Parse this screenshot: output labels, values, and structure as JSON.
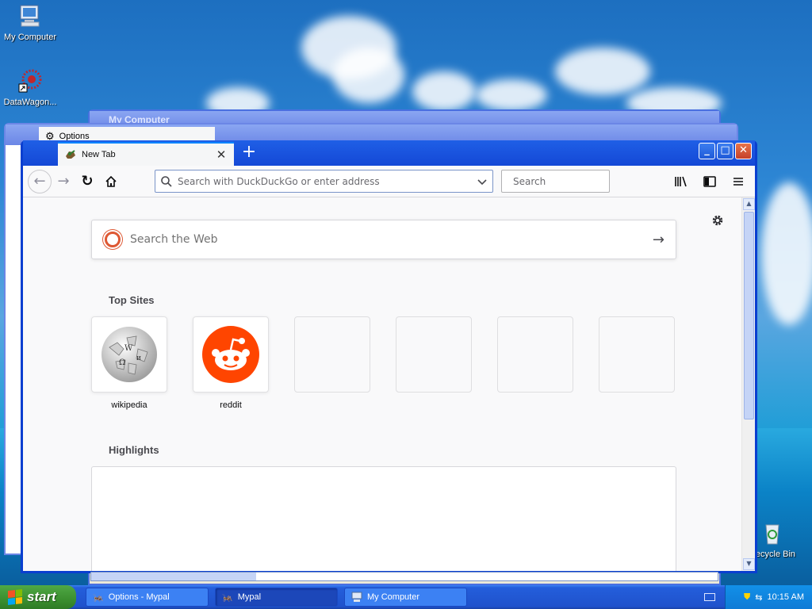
{
  "desktop": {
    "icons": [
      {
        "label": "My Computer"
      },
      {
        "label": "DataWagon..."
      },
      {
        "label": "Recycle Bin"
      }
    ]
  },
  "background_windows": {
    "my_computer_title": "My Computer",
    "options_tab_title": "Options"
  },
  "browser": {
    "tab": {
      "title": "New Tab",
      "close": "✕"
    },
    "new_tab": "+",
    "window_controls": {
      "minimize": "_",
      "maximize": "□",
      "close": "✕"
    },
    "nav": {
      "back": "←",
      "forward": "→",
      "reload": "↻",
      "home": "⌂"
    },
    "urlbar": {
      "placeholder": "Search with DuckDuckGo or enter address",
      "value": ""
    },
    "searchbar": {
      "placeholder": "Search",
      "value": ""
    },
    "content": {
      "web_search": {
        "placeholder": "Search the Web"
      },
      "top_sites_title": "Top Sites",
      "top_sites": [
        {
          "label": "wikipedia",
          "icon": "wikipedia-icon"
        },
        {
          "label": "reddit",
          "icon": "reddit-icon"
        },
        {
          "label": ""
        },
        {
          "label": ""
        },
        {
          "label": ""
        },
        {
          "label": ""
        }
      ],
      "highlights_title": "Highlights"
    }
  },
  "taskbar": {
    "start_label": "start",
    "tasks": [
      {
        "label": "Options - Mypal"
      },
      {
        "label": "Mypal"
      },
      {
        "label": "My Computer"
      }
    ],
    "clock": "10:15 AM"
  },
  "colors": {
    "xp_blue": "#0a3fd0",
    "start_green": "#3b8f2f",
    "ddg_orange": "#de5833",
    "reddit_orange": "#ff4500"
  }
}
